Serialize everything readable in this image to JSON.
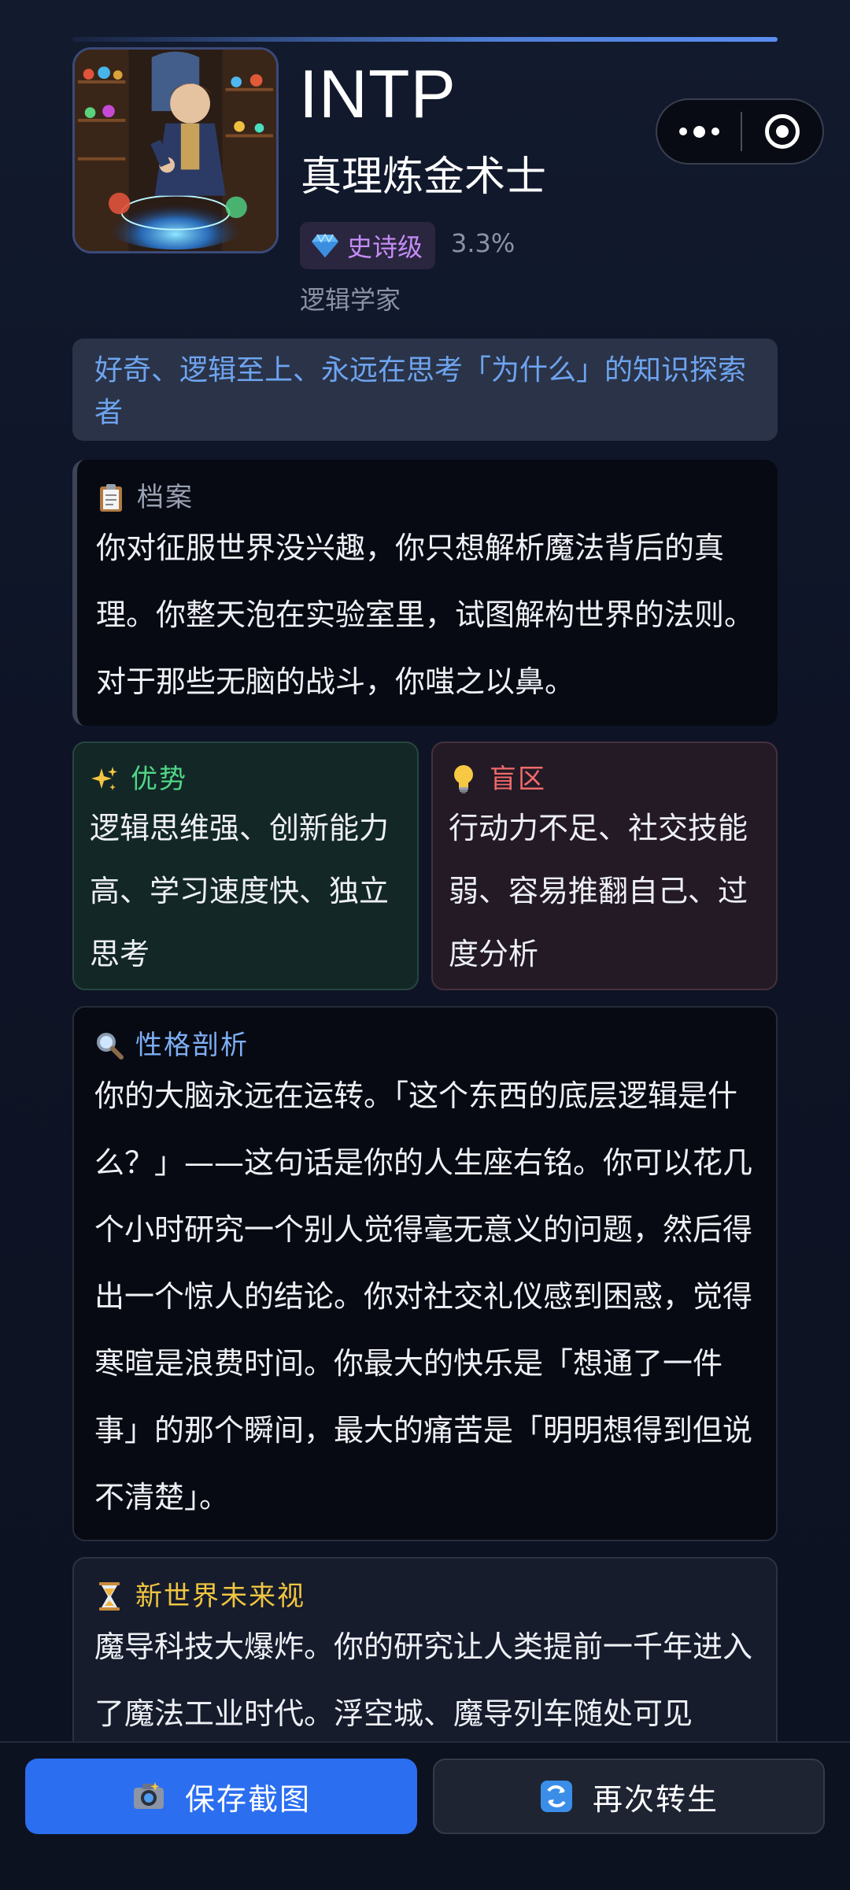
{
  "profile": {
    "code": "INTP",
    "name": "真理炼金术士",
    "rarity_label": "史诗级",
    "rarity_icon": "diamond-icon",
    "percent": "3.3%",
    "subtitle": "逻辑学家",
    "tagline": "好奇、逻辑至上、永远在思考「为什么」的知识探索者"
  },
  "sections": {
    "dossier": {
      "icon": "clipboard-icon",
      "title": "档案",
      "body": "你对征服世界没兴趣，你只想解析魔法背后的真理。你整天泡在实验室里，试图解构世界的法则。对于那些无脑的战斗，你嗤之以鼻。"
    },
    "strengths": {
      "icon": "sparkles-icon",
      "title": "优势",
      "body": "逻辑思维强、创新能力高、学习速度快、独立思考"
    },
    "blindspots": {
      "icon": "lightbulb-icon",
      "title": "盲区",
      "body": "行动力不足、社交技能弱、容易推翻自己、过度分析"
    },
    "analysis": {
      "icon": "magnifier-icon",
      "title": "性格剖析",
      "body": "你的大脑永远在运转。「这个东西的底层逻辑是什么？」——这句话是你的人生座右铭。你可以花几个小时研究一个别人觉得毫无意义的问题，然后得出一个惊人的结论。你对社交礼仪感到困惑，觉得寒暄是浪费时间。你最大的快乐是「想通了一件事」的那个瞬间，最大的痛苦是「明明想得到但说不清楚」。"
    },
    "future": {
      "icon": "hourglass-icon",
      "title": "新世界未来视",
      "body": "魔导科技大爆炸。你的研究让人类提前一千年进入了魔法工业时代。浮空城、魔导列车随处可见"
    }
  },
  "actions": {
    "save_label": "保存截图",
    "save_icon": "camera-icon",
    "again_label": "再次转生",
    "again_icon": "refresh-icon"
  },
  "colors": {
    "accent_blue": "#2b6ef0",
    "rarity_purple": "#c58cf5",
    "strength_green": "#4fd686",
    "weak_red": "#f06a6a",
    "future_gold": "#f0c541",
    "analysis_blue": "#7eaef5"
  }
}
